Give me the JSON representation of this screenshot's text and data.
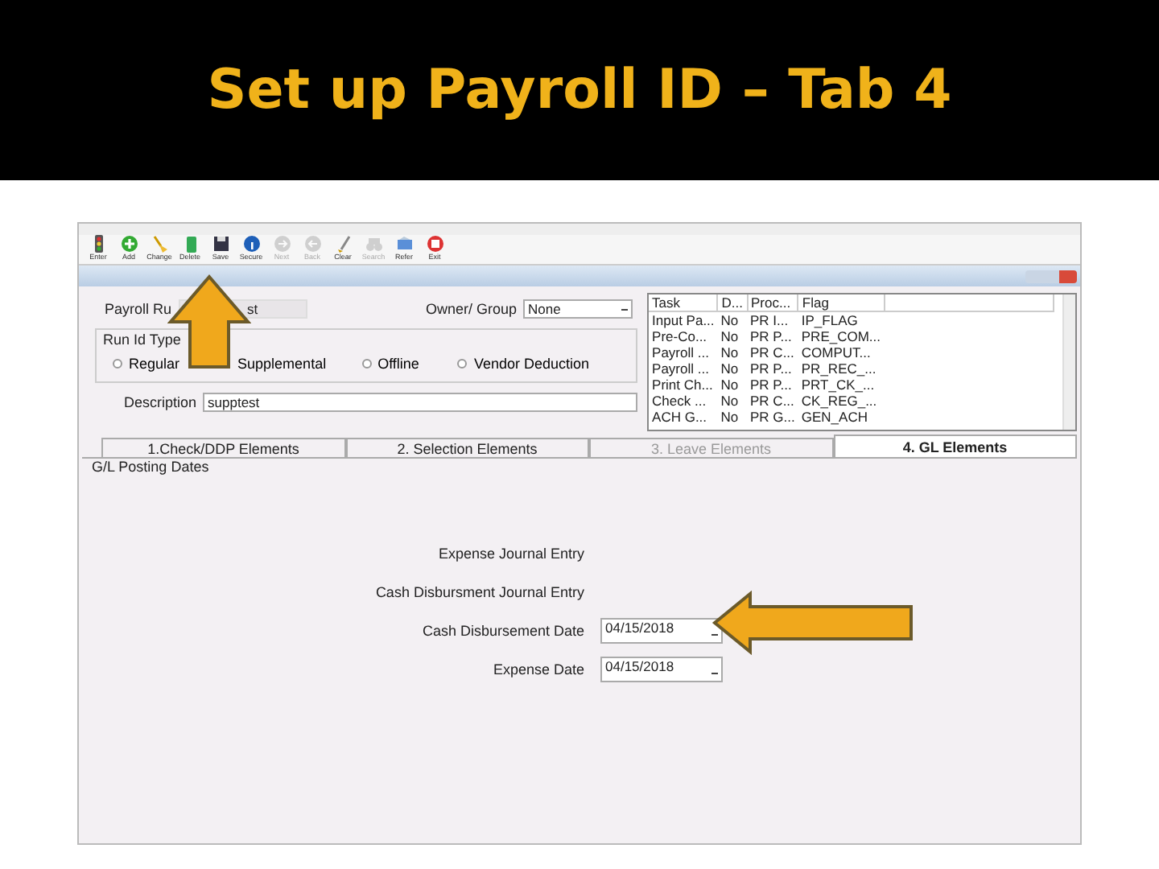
{
  "slide": {
    "title": "Set up Payroll ID – Tab 4"
  },
  "toolbar": [
    {
      "label": "Enter",
      "kind": "light",
      "disabled": false
    },
    {
      "label": "Add",
      "kind": "plus",
      "disabled": false
    },
    {
      "label": "Change",
      "kind": "brush",
      "disabled": false
    },
    {
      "label": "Delete",
      "kind": "can",
      "disabled": false
    },
    {
      "label": "Save",
      "kind": "disk",
      "disabled": false
    },
    {
      "label": "Secure",
      "kind": "info",
      "disabled": false
    },
    {
      "label": "Next",
      "kind": "next",
      "disabled": true
    },
    {
      "label": "Back",
      "kind": "back",
      "disabled": true
    },
    {
      "label": "Clear",
      "kind": "brush2",
      "disabled": false
    },
    {
      "label": "Search",
      "kind": "binoc",
      "disabled": true
    },
    {
      "label": "Refer",
      "kind": "refer",
      "disabled": false
    },
    {
      "label": "Exit",
      "kind": "exit",
      "disabled": false
    }
  ],
  "form": {
    "payroll_run": {
      "label": "Payroll Ru",
      "value": "st"
    },
    "owner_group": {
      "label": "Owner/ Group",
      "value": "None"
    },
    "run_id_type": {
      "label": "Run Id Type",
      "options": [
        {
          "label": "Regular",
          "selected": false
        },
        {
          "label": "Supplemental"
        },
        {
          "label": "Offline",
          "selected": false
        },
        {
          "label": "Vendor Deduction",
          "selected": false
        }
      ]
    },
    "description": {
      "label": "Description",
      "value": "supptest"
    }
  },
  "task_grid": {
    "columns": [
      "Task",
      "D...",
      "Proc...",
      "Flag"
    ],
    "rows": [
      [
        "Input Pa...",
        "No",
        "PR I...",
        "IP_FLAG"
      ],
      [
        "Pre-Co...",
        "No",
        "PR P...",
        "PRE_COM..."
      ],
      [
        "Payroll ...",
        "No",
        "PR C...",
        "COMPUT..."
      ],
      [
        "Payroll ...",
        "No",
        "PR P...",
        "PR_REC_..."
      ],
      [
        "Print Ch...",
        "No",
        "PR P...",
        "PRT_CK_..."
      ],
      [
        "Check ...",
        "No",
        "PR C...",
        "CK_REG_..."
      ],
      [
        "ACH G...",
        "No",
        "PR G...",
        "GEN_ACH"
      ]
    ]
  },
  "tabs": [
    {
      "label": "1.Check/DDP Elements",
      "selected": false,
      "disabled": false
    },
    {
      "label": "2. Selection Elements",
      "selected": false,
      "disabled": false
    },
    {
      "label": "3. Leave Elements",
      "selected": false,
      "disabled": true
    },
    {
      "label": "4. GL Elements",
      "selected": true,
      "disabled": false
    }
  ],
  "gl_posting": {
    "title": "G/L Posting Dates",
    "fields": [
      {
        "label": "Expense Journal Entry",
        "kind": "label"
      },
      {
        "label": "Cash Disbursment Journal Entry",
        "kind": "label"
      },
      {
        "label": "Cash Disbursement Date",
        "kind": "date",
        "value": "04/15/2018"
      },
      {
        "label": "Expense Date",
        "kind": "date",
        "value": "04/15/2018"
      }
    ]
  }
}
